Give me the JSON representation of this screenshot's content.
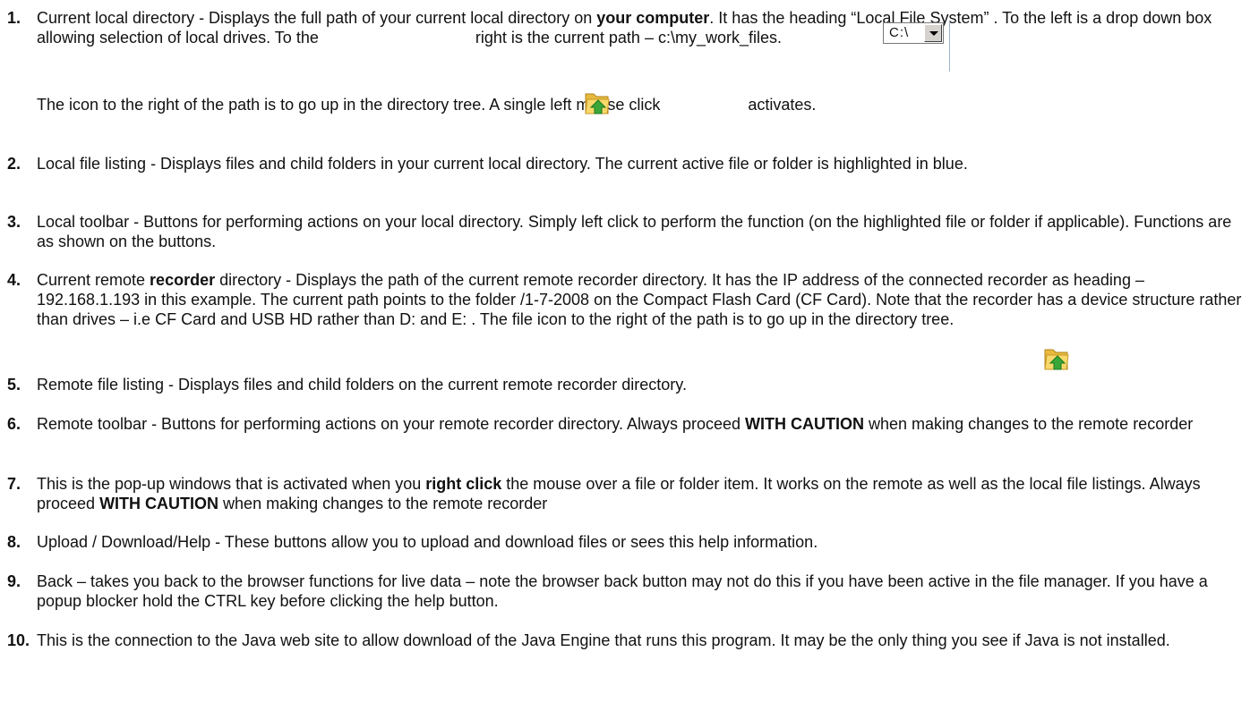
{
  "items": [
    {
      "num": "1.",
      "parts": [
        "Current local directory - Displays the full path of your current local directory on ",
        "your computer",
        ". It has the heading “Local File System” . To the left is a drop down box  allowing selection of local drives. To the ",
        "right is the current path – c:\\my_work_files."
      ]
    },
    {
      "num": "2.",
      "text": "Local file listing - Displays files and child folders in your current local directory. The current active file or folder is highlighted in blue."
    },
    {
      "num": "3.",
      "text": "Local toolbar - Buttons for performing actions on your local directory. Simply left click to perform the function (on the highlighted file or folder if applicable). Functions are as shown on the buttons."
    },
    {
      "num": "4.",
      "parts": [
        "Current remote ",
        "recorder",
        " directory - Displays the path of the current remote recorder directory. It has the IP address of the connected recorder as heading – 192.168.1.193 in this example. The current path points to the folder  /1-7-2008  on the Compact Flash Card (CF Card). Note that the recorder has a device structure rather than drives – i.e  CF Card and USB HD rather than D: and E: . The file icon to the right of the path is to go up in the directory tree."
      ]
    },
    {
      "num": "5.",
      "text": "Remote file listing - Displays files and child folders on the current remote recorder directory."
    },
    {
      "num": "6.",
      "parts": [
        "Remote toolbar - Buttons for performing actions on your remote recorder directory. Always proceed ",
        "WITH CAUTION",
        " when making changes to the remote recorder"
      ]
    },
    {
      "num": "7.",
      "parts": [
        "This is the pop-up windows that is activated when you ",
        "right click",
        " the mouse over a file or folder item. It works on the remote as well as the local file listings. Always proceed ",
        "WITH CAUTION",
        " when making changes to the remote recorder"
      ]
    },
    {
      "num": "8.",
      "text": "Upload / Download/Help - These buttons allow you to upload and download files or sees this help information."
    },
    {
      "num": "9.",
      "text": "Back – takes you back to the browser functions for live data – note the browser back button may not do this if you have been active in the file manager. If you have a popup blocker hold the CTRL key before clicking the help button."
    },
    {
      "num": "10.",
      "text": "This is the connection to the Java web site to allow download of the Java Engine that runs this program. It may be the only thing you see if Java is not installed."
    }
  ],
  "note": {
    "before": "The icon to the right of the path is to go up in the directory tree. A single left mouse click",
    "after": "activates."
  },
  "widgets": {
    "drive": "C:\\",
    "dropdown_icon": "chevron-down-icon",
    "up_icon": "folder-up-icon"
  },
  "colors": {
    "folder": "#f5d25a",
    "arrow": "#3aa63a",
    "text": "#111111"
  }
}
